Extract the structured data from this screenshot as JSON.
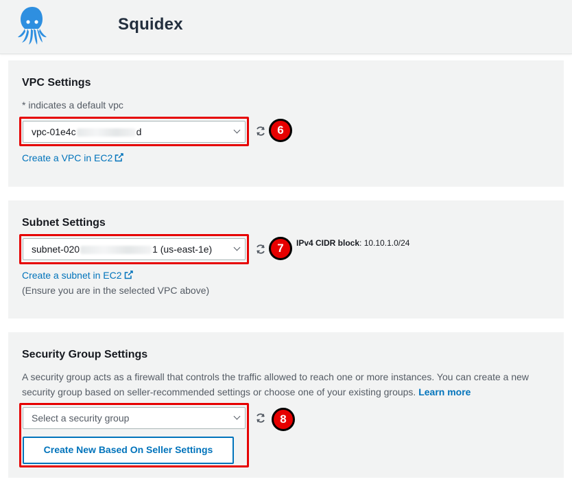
{
  "header": {
    "brand": "Squidex",
    "logo_icon": "squid-logo-icon"
  },
  "vpc": {
    "title": "VPC Settings",
    "hint": "* indicates a default vpc",
    "select_prefix": "vpc-01e4c",
    "select_suffix": "d",
    "link": "Create a VPC in EC2",
    "badge": "6"
  },
  "subnet": {
    "title": "Subnet Settings",
    "select_prefix": "subnet-020",
    "select_suffix": "1 (us-east-1e)",
    "cidr_label": "IPv4 CIDR block",
    "cidr_value": ": 10.10.1.0/24",
    "link": "Create a subnet in EC2",
    "note": "(Ensure you are in the selected VPC above)",
    "badge": "7"
  },
  "security": {
    "title": "Security Group Settings",
    "description": "A security group acts as a firewall that controls the traffic allowed to reach one or more instances. You can create a new security group based on seller-recommended settings or choose one of your existing groups.",
    "learn_more": "Learn more",
    "select_placeholder": "Select a security group",
    "button": "Create New Based On Seller Settings",
    "badge": "8"
  },
  "colors": {
    "highlight": "#e60000",
    "link": "#0073bb",
    "panel": "#f2f3f3",
    "logo": "#2e8fe0"
  }
}
